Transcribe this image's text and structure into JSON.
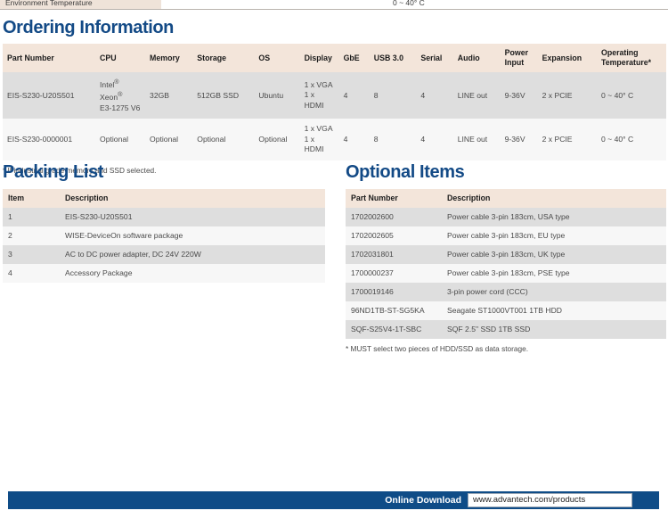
{
  "truncated_spec_row": {
    "label": "Environment Temperature",
    "value": "0 ~ 40° C"
  },
  "ordering": {
    "title": "Ordering Information",
    "headers": [
      "Part Number",
      "CPU",
      "Memory",
      "Storage",
      "OS",
      "Display",
      "GbE",
      "USB 3.0",
      "Serial",
      "Audio",
      "Power Input",
      "Expansion",
      "Operating Temperature*"
    ],
    "rows": [
      {
        "part_number": "EIS-S230-U20S501",
        "cpu": "Intel® Xeon® E3-1275 V6",
        "memory": "32GB",
        "storage": "512GB SSD",
        "os": "Ubuntu",
        "display": "1 x VGA 1 x HDMI",
        "gbe": "4",
        "usb30": "8",
        "serial": "4",
        "audio": "LINE out",
        "power_input": "9-36V",
        "expansion": "2 x PCIE",
        "operating_temperature": "0 ~ 40° C"
      },
      {
        "part_number": "EIS-S230-0000001",
        "cpu": "Optional",
        "memory": "Optional",
        "storage": "Optional",
        "os": "Optional",
        "display": "1 x VGA 1 x HDMI",
        "gbe": "4",
        "usb30": "8",
        "serial": "4",
        "audio": "LINE out",
        "power_input": "9-36V",
        "expansion": "2 x PCIE",
        "operating_temperature": "0 ~ 40° C"
      }
    ],
    "footnote": "* If industrial grade memory and SSD selected."
  },
  "packing_list": {
    "title": "Packing List",
    "headers": [
      "Item",
      "Description"
    ],
    "rows": [
      {
        "item": "1",
        "description": "EIS-S230-U20S501"
      },
      {
        "item": "2",
        "description": "WISE-DeviceOn software package"
      },
      {
        "item": "3",
        "description": "AC to DC power adapter, DC 24V 220W"
      },
      {
        "item": "4",
        "description": "Accessory Package"
      }
    ]
  },
  "optional_items": {
    "title": "Optional Items",
    "headers": [
      "Part Number",
      "Description"
    ],
    "rows": [
      {
        "part_number": "1702002600",
        "description": "Power cable 3-pin 183cm, USA type"
      },
      {
        "part_number": "1702002605",
        "description": "Power cable 3-pin 183cm, EU type"
      },
      {
        "part_number": "1702031801",
        "description": "Power cable 3-pin 183cm, UK type"
      },
      {
        "part_number": "1700000237",
        "description": "Power cable 3-pin 183cm, PSE type"
      },
      {
        "part_number": "1700019146",
        "description": "3-pin power cord (CCC)"
      },
      {
        "part_number": "96ND1TB-ST-SG5KA",
        "description": "Seagate ST1000VT001 1TB HDD"
      },
      {
        "part_number": "SQF-S25V4-1T-SBC",
        "description": "SQF 2.5\" SSD 1TB SSD"
      }
    ],
    "footnote": "* MUST select two pieces of HDD/SSD as data storage."
  },
  "footer": {
    "download_label": "Online Download",
    "url": "www.advantech.com/products"
  },
  "colors": {
    "heading_blue": "#134a86",
    "footer_blue": "#0f4c87",
    "table_header_bg": "#f3e5da",
    "row_odd_bg": "#dedede",
    "row_even_bg": "#f7f7f7"
  }
}
